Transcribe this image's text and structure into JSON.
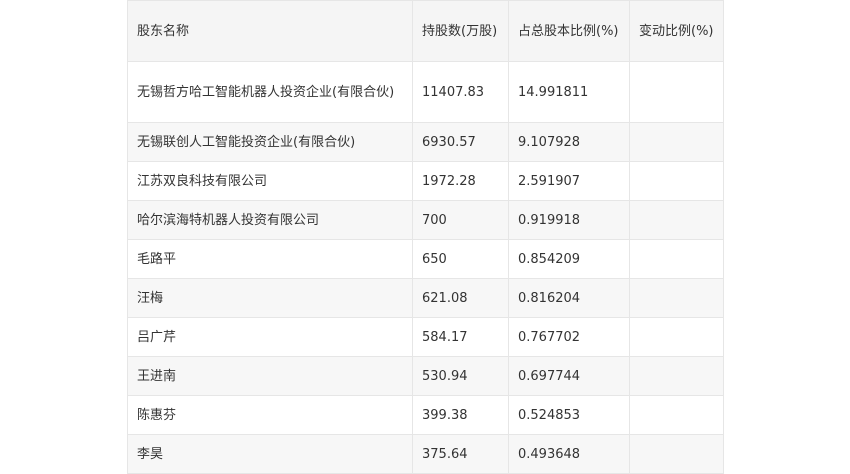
{
  "headers": {
    "name": "股东名称",
    "shares": "持股数(万股)",
    "percent": "占总股本比例(%)",
    "change": "变动比例(%)"
  },
  "rows": [
    {
      "name": "无锡哲方哈工智能机器人投资企业(有限合伙)",
      "shares": "11407.83",
      "percent": "14.991811",
      "change": ""
    },
    {
      "name": "无锡联创人工智能投资企业(有限合伙)",
      "shares": "6930.57",
      "percent": "9.107928",
      "change": ""
    },
    {
      "name": "江苏双良科技有限公司",
      "shares": "1972.28",
      "percent": "2.591907",
      "change": ""
    },
    {
      "name": "哈尔滨海特机器人投资有限公司",
      "shares": "700",
      "percent": "0.919918",
      "change": ""
    },
    {
      "name": "毛路平",
      "shares": "650",
      "percent": "0.854209",
      "change": ""
    },
    {
      "name": "汪梅",
      "shares": "621.08",
      "percent": "0.816204",
      "change": ""
    },
    {
      "name": "吕广芹",
      "shares": "584.17",
      "percent": "0.767702",
      "change": ""
    },
    {
      "name": "王进南",
      "shares": "530.94",
      "percent": "0.697744",
      "change": ""
    },
    {
      "name": "陈惠芬",
      "shares": "399.38",
      "percent": "0.524853",
      "change": ""
    },
    {
      "name": "李昊",
      "shares": "375.64",
      "percent": "0.493648",
      "change": ""
    }
  ]
}
